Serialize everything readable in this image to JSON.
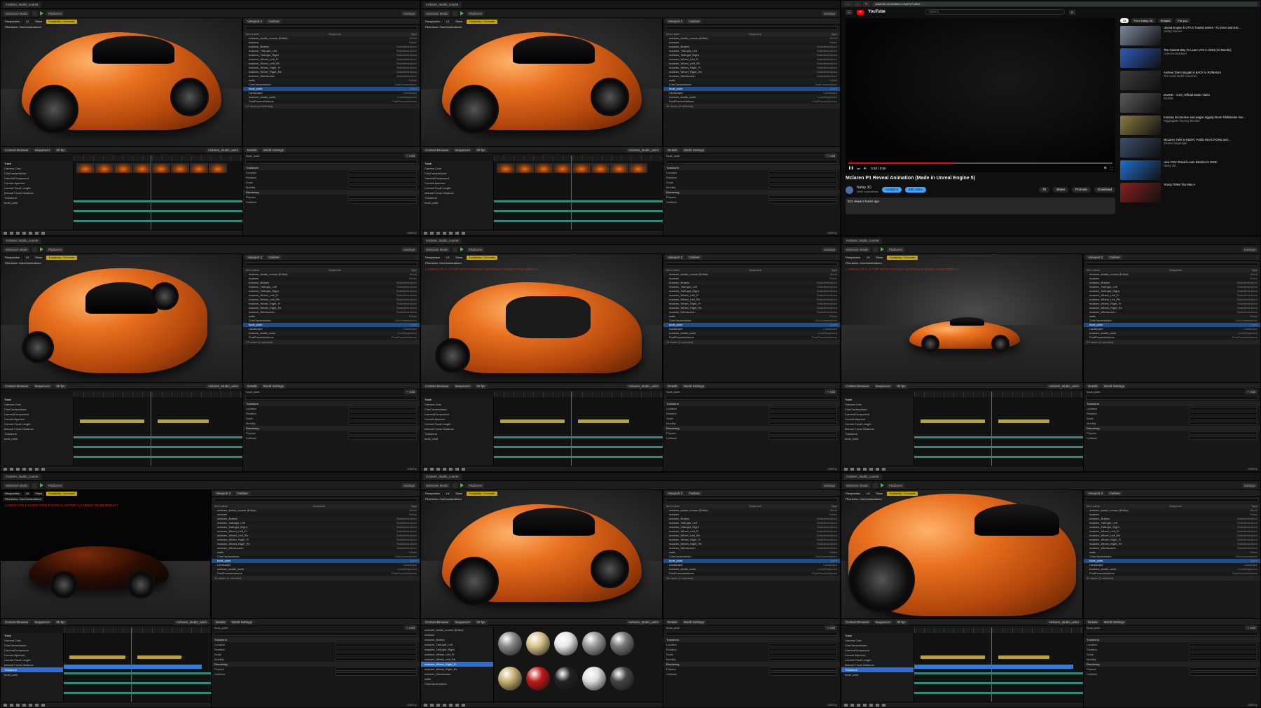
{
  "common": {
    "level_tab": "mclaren_studio_course",
    "selection_mode": "Selection Mode",
    "platforms": "Platforms",
    "settings": "Settings",
    "perspective": "Perspective",
    "lit": "Lit",
    "show": "Show",
    "scalability": "Scalability: Cinematic",
    "pilot": "Pilot Actor: CineCameraActor",
    "viewport2": "Viewport 2",
    "outliner": "Outliner",
    "item_label": "Item Label",
    "sequence": "Sequence",
    "type": "Type",
    "details": "Details",
    "world_settings": "World Settings",
    "content_browser": "Content Browser",
    "sequencer": "Sequencer",
    "track": "Track",
    "fps": "30 fps",
    "add": "+ Add",
    "udemy": "Udemy",
    "warning_text": "LANDSCAPE 1 ACTOR WITH PHYSICAL MATERIALS NEEDS TO BE REBUILT"
  },
  "outliner_rows": [
    {
      "label": "mclaren_studio_course (Editor)",
      "type": "World"
    },
    {
      "label": "mclaren",
      "type": "Folder"
    },
    {
      "label": "mclaren_Brakes",
      "type": "StaticMeshActor"
    },
    {
      "label": "mclaren_TailLight_Left",
      "type": "StaticMeshActor"
    },
    {
      "label": "mclaren_TailLight_Right",
      "type": "StaticMeshActor"
    },
    {
      "label": "mclaren_Wheel_Left_Fr",
      "type": "StaticMeshActor"
    },
    {
      "label": "mclaren_Wheel_Left_Re",
      "type": "StaticMeshActor"
    },
    {
      "label": "mclaren_Wheel_Right_Fr",
      "type": "StaticMeshActor"
    },
    {
      "label": "mclaren_Wheel_Right_Re",
      "type": "StaticMeshActor"
    },
    {
      "label": "mclaren_Windscreen",
      "type": "StaticMeshActor"
    },
    {
      "label": "walls",
      "type": "Folder"
    },
    {
      "label": "CineCameraActor",
      "type": "CineCameraActor"
    },
    {
      "label": "focal_point",
      "type": "Actor"
    },
    {
      "label": "Landscape",
      "type": "Landscape"
    },
    {
      "label": "mclaren_studio_anim",
      "type": "LevelSequence"
    },
    {
      "label": "PostProcessVolume",
      "type": "PostProcessVolume"
    }
  ],
  "detail_rows": [
    {
      "label": "Transform"
    },
    {
      "label": "Location"
    },
    {
      "label": "Rotation"
    },
    {
      "label": "Scale"
    },
    {
      "label": "Mobility"
    },
    {
      "label": "Rendering"
    },
    {
      "label": "Physics"
    },
    {
      "label": "Collision"
    }
  ],
  "seq_tracks": [
    "Camera Cuts",
    "CineCameraActor",
    "CameraComponent",
    "Current Aperture",
    "Current Focal Length",
    "Manual Focus Distance",
    "Transform",
    "focal_point"
  ],
  "actor_count": "31 actors (1 selected)",
  "youtube": {
    "url": "youtube.com/watch?v=MzPjr7u5tUI",
    "wordmark": "YouTube",
    "search_placeholder": "Search",
    "time": "0:20 / 0:50",
    "progress": 0.4,
    "title": "Mclaren P1 Reveal Animation (Made in Unreal Engine 5)",
    "channel": "Nafay 3D",
    "subs": "285K subscribers",
    "analytics": "Analytics",
    "edit_video": "Edit video",
    "likes": "78",
    "share": "Share",
    "promote": "Promote",
    "download": "Download",
    "views": "512 views  5 hours ago",
    "chips": [
      "All",
      "From Nafay 3D",
      "Related",
      "For you"
    ],
    "recs": [
      {
        "title": "Unreal Engine 5 GTA 6 Tutorial Series - #1 Enter and Exit...",
        "sub": "Smitty Games",
        "color": "#7a8aa0"
      },
      {
        "title": "The Fastest Way To Learn VFX in 2024 (12 Months)",
        "sub": "Lorenzo Bruckner",
        "color": "#2f5bbf"
      },
      {
        "title": "Andrew Tate's Bugatti is BACK in ROMANIA",
        "sub": "The Hard World Unicorns",
        "color": "#3b3b3b"
      },
      {
        "title": "DIVINE - 4:10 | Official Music Video",
        "sub": "DIVINE",
        "color": "#5a5a5a"
      },
      {
        "title": "Fantasy locomotive and wagon rigging #Irum #3dblender #ve...",
        "sub": "RiggingBits Factory Blender",
        "color": "#8a7b42"
      },
      {
        "title": "McLaren 750s in INDIA | Public REACTIONS and...",
        "sub": "Vikram Nagarajan",
        "color": "#3b4e6a"
      },
      {
        "title": "How YOU Should Learn Blender In 2024!",
        "sub": "Nafay 3D",
        "color": "#1f6fd0"
      },
      {
        "title": "Young Tinker Tea Mao A",
        "sub": "",
        "color": "#8a1f1f"
      }
    ]
  }
}
